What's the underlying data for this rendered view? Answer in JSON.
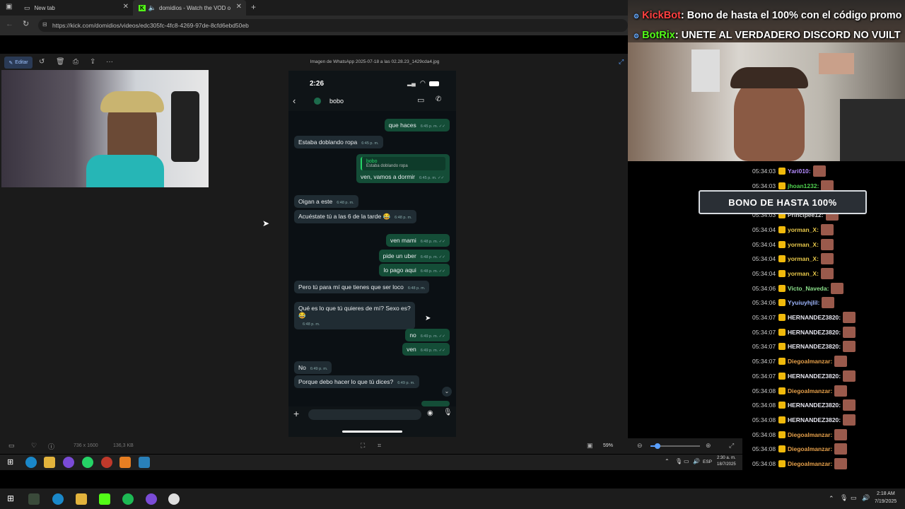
{
  "browser": {
    "tabs": [
      {
        "title": "New tab"
      },
      {
        "title": "domidios - Watch the VOD o"
      }
    ],
    "url": "https://kick.com/domidios/videos/edc305fc-4fc8-4269-97de-8cfd6ebd50eb"
  },
  "viewer": {
    "edit_label": "Editar",
    "image_title": "Imagen de WhatsApp 2025-07-18 a las 02.28.23_1429cda4.jpg",
    "footer": {
      "dimensions": "736 x 1600",
      "size": "136,3 KB",
      "zoom": "59%"
    }
  },
  "phone": {
    "time": "2:26",
    "contact": "bobo"
  },
  "messages": [
    {
      "dir": "out",
      "text": "que haces",
      "time": "6:45 p. m."
    },
    {
      "dir": "in",
      "text": "Estaba doblando ropa",
      "time": "6:45 p. m."
    },
    {
      "dir": "out",
      "quote_name": "bobo",
      "quote_text": "Estaba doblando ropa",
      "text": "ven, vamos a dormir",
      "time": "6:45 p. m."
    },
    {
      "dir": "in",
      "text": "Oigan a este",
      "time": "6:48 p. m."
    },
    {
      "dir": "in",
      "text": "Acuéstate tú a las 6 de la tarde 😂",
      "time": "6:48 p. m."
    },
    {
      "dir": "out",
      "text": "ven mami",
      "time": "6:48 p. m."
    },
    {
      "dir": "out",
      "text": "pide un uber",
      "time": "6:48 p. m."
    },
    {
      "dir": "out",
      "text": "lo pago aqui",
      "time": "6:48 p. m."
    },
    {
      "dir": "in",
      "text": "Pero tú para mí que tienes que ser loco",
      "time": "6:48 p. m."
    },
    {
      "dir": "in",
      "text": "Qué es lo que tú quieres de mí? Sexo es?",
      "emoji": "😂",
      "time": "6:48 p. m."
    },
    {
      "dir": "out",
      "text": "no",
      "time": "6:49 p. m."
    },
    {
      "dir": "out",
      "text": "ven",
      "time": "6:49 p. m."
    },
    {
      "dir": "in",
      "text": "No",
      "time": "6:49 p. m."
    },
    {
      "dir": "in",
      "text": "Porque debo hacer lo que tú dices?",
      "time": "6:49 p. m."
    }
  ],
  "inner_taskbar": {
    "time": "2:30 a. m.",
    "date": "18/7/2025",
    "lang": "ESP"
  },
  "outer_taskbar": {
    "time": "2:18 AM",
    "date": "7/19/2025"
  },
  "overlay": {
    "line1_user": "KickBot",
    "line1_text": ": Bono de hasta el 100% con el código promo",
    "line2_user": "BotRix",
    "line2_text": ": UNETE AL VERDADERO DISCORD NO VUILT",
    "banner": "BONO DE HASTA 100%"
  },
  "chat": [
    {
      "time": "05:34:03",
      "user": "Yari010:",
      "color": "#b58cff"
    },
    {
      "time": "05:34:03",
      "user": "jhoan1232:",
      "color": "#4fd14f"
    },
    {
      "time": "05:34:03",
      "user": "Principee12:",
      "color": "#cfcfcf"
    },
    {
      "time": "05:34:03",
      "user": "Principee12:",
      "color": "#cfcfcf"
    },
    {
      "time": "05:34:04",
      "user": "yorman_X:",
      "color": "#e8c84a"
    },
    {
      "time": "05:34:04",
      "user": "yorman_X:",
      "color": "#e8c84a"
    },
    {
      "time": "05:34:04",
      "user": "yorman_X:",
      "color": "#e8c84a"
    },
    {
      "time": "05:34:04",
      "user": "yorman_X:",
      "color": "#e8c84a"
    },
    {
      "time": "05:34:06",
      "user": "Victo_Naveda:",
      "color": "#8be08b"
    },
    {
      "time": "05:34:06",
      "user": "Yyuiuyhjlil:",
      "color": "#9fb7ff"
    },
    {
      "time": "05:34:07",
      "user": "HERNANDEZ3820:",
      "color": "#e6e6f0"
    },
    {
      "time": "05:34:07",
      "user": "HERNANDEZ3820:",
      "color": "#e6e6f0"
    },
    {
      "time": "05:34:07",
      "user": "HERNANDEZ3820:",
      "color": "#e6e6f0"
    },
    {
      "time": "05:34:07",
      "user": "Diegoalmanzar:",
      "color": "#e6a04a"
    },
    {
      "time": "05:34:07",
      "user": "HERNANDEZ3820:",
      "color": "#e6e6f0"
    },
    {
      "time": "05:34:08",
      "user": "Diegoalmanzar:",
      "color": "#e6a04a"
    },
    {
      "time": "05:34:08",
      "user": "HERNANDEZ3820:",
      "color": "#e6e6f0"
    },
    {
      "time": "05:34:08",
      "user": "HERNANDEZ3820:",
      "color": "#e6e6f0"
    },
    {
      "time": "05:34:08",
      "user": "Diegoalmanzar:",
      "color": "#e6a04a"
    },
    {
      "time": "05:34:08",
      "user": "Diegoalmanzar:",
      "color": "#e6a04a"
    },
    {
      "time": "05:34:08",
      "user": "Diegoalmanzar:",
      "color": "#e6a04a"
    }
  ],
  "colors": {
    "kickbot": "#ff4040",
    "botrix": "#53fc18",
    "out_bubble": "#144d37",
    "in_bubble": "#202c33"
  }
}
